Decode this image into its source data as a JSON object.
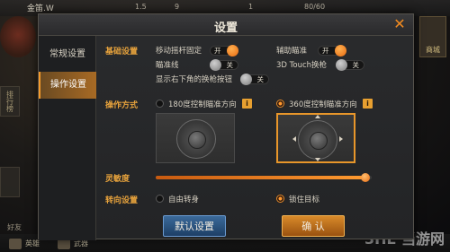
{
  "hud": {
    "player_name": "金笛.W",
    "stat_1": "1.5",
    "stat_2": "9",
    "stat_3": "1",
    "energy": "80/60",
    "right_button": "商城",
    "side_btn_1": "排行榜",
    "bottom_item_1": "英雄",
    "bottom_item_2": "武器",
    "bottom_left": "好友",
    "watermark": "3HE 当游网"
  },
  "dialog": {
    "title": "设置",
    "close_icon": "close-icon"
  },
  "tabs": [
    {
      "label": "常规设置"
    },
    {
      "label": "操作设置"
    }
  ],
  "basic": {
    "section_label": "基础设置",
    "joystick_fixed_label": "移动摇杆固定",
    "joystick_fixed_state": "开",
    "aim_assist_label": "辅助瞄准",
    "aim_assist_state": "开",
    "crosshair_label": "瞄准线",
    "crosshair_state": "关",
    "touch3d_label": "3D Touch换枪",
    "touch3d_state": "关",
    "bottom_right_label": "显示右下角的换枪按钮",
    "bottom_right_state": "关"
  },
  "control": {
    "section_label": "操作方式",
    "option_180": "180度控制瞄准方向",
    "option_360": "360度控制瞄准方向",
    "info_icon_text": "i"
  },
  "sensitivity": {
    "label": "灵敏度",
    "value": 0.97
  },
  "turn": {
    "section_label": "转向设置",
    "option_free": "自由转身",
    "option_lock": "锁住目标"
  },
  "buttons": {
    "default": "默认设置",
    "confirm": "确 认"
  },
  "colors": {
    "accent": "#f49a2a",
    "section": "#e6a23c"
  }
}
